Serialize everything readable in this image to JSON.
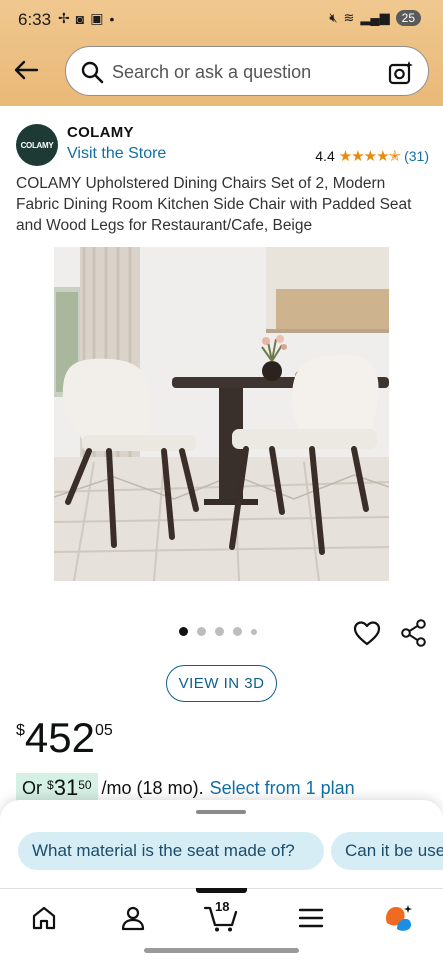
{
  "status_bar": {
    "time": "6:33",
    "battery": "25"
  },
  "search": {
    "placeholder": "Search or ask a question"
  },
  "brand": {
    "logo_text": "COLAMY",
    "name": "COLAMY",
    "visit_store": "Visit the Store"
  },
  "rating": {
    "value": "4.4",
    "stars": "★★★★✭",
    "count": "(31)"
  },
  "product": {
    "title": "COLAMY Upholstered Dining Chairs Set of 2, Modern Fabric Dining Room Kitchen Side Chair with Padded Seat and Wood Legs for Restaurant/Cafe, Beige",
    "image_count": 5,
    "active_image": 1
  },
  "actions": {
    "view_3d": "VIEW IN 3D"
  },
  "price": {
    "currency": "$",
    "whole": "452",
    "fraction": "05"
  },
  "installment": {
    "prefix": "Or",
    "currency": "$",
    "whole": "31",
    "fraction": "50",
    "suffix": "/mo (18 mo).",
    "link": "Select from 1 plan"
  },
  "ask_chips": [
    "What material is the seat made of?",
    "Can it be used"
  ],
  "nav": {
    "cart_count": "18"
  },
  "colors": {
    "header": "#ecbf82",
    "link": "#116fa3",
    "star": "#e78b0e",
    "chip_bg": "#d7edf5",
    "installment_bg": "#d5f0e4"
  }
}
